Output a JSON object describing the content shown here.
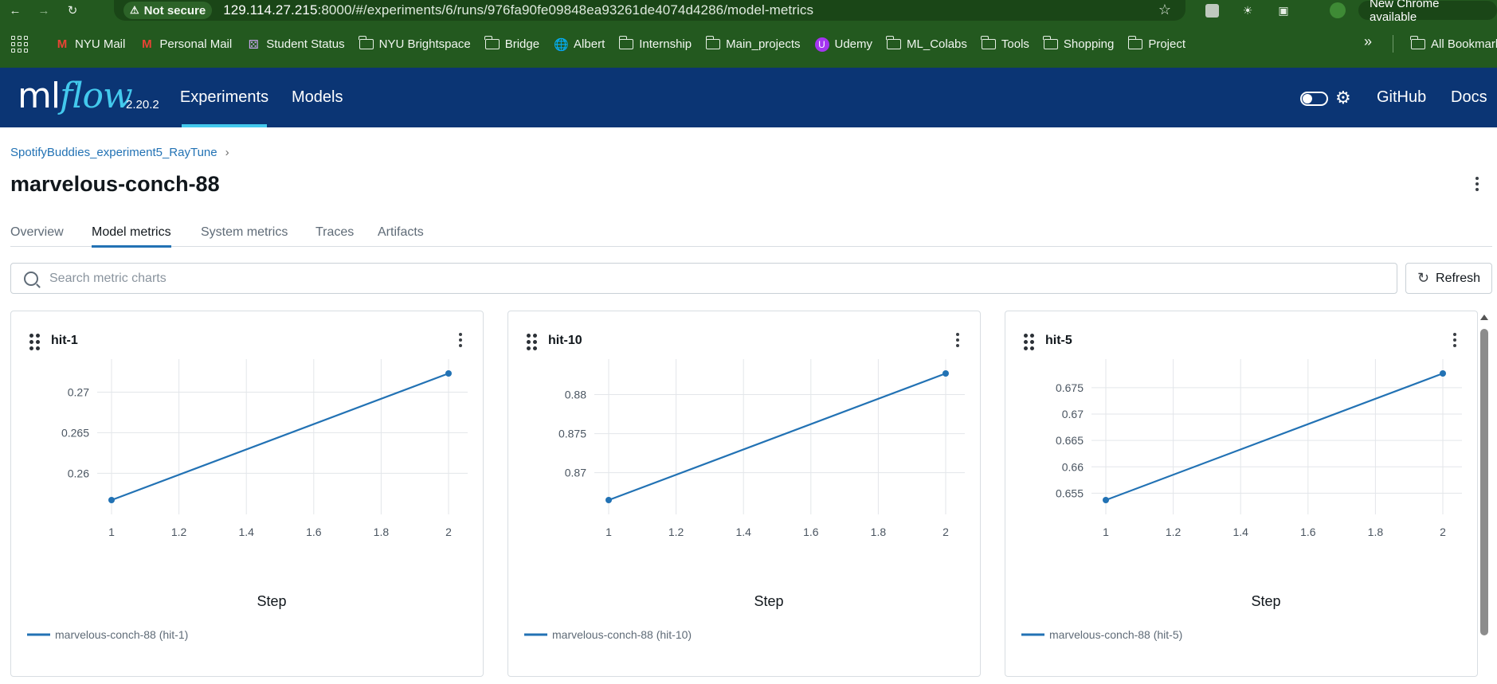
{
  "browser": {
    "security_label": "Not secure",
    "url_host": "129.114.27.215",
    "url_rest": ":8000/#/experiments/6/runs/976fa90fe09848ea93261de4074d4286/model-metrics",
    "new_chrome_label": "New Chrome available"
  },
  "bookmarks": [
    {
      "label": "NYU Mail",
      "icon": "gmail-icon"
    },
    {
      "label": "Personal Mail",
      "icon": "gmail-icon"
    },
    {
      "label": "Student Status",
      "icon": "nyu-icon"
    },
    {
      "label": "NYU Brightspace",
      "icon": "folder-icon"
    },
    {
      "label": "Bridge",
      "icon": "folder-icon"
    },
    {
      "label": "Albert",
      "icon": "globe-icon"
    },
    {
      "label": "Internship",
      "icon": "folder-icon"
    },
    {
      "label": "Main_projects",
      "icon": "folder-icon"
    },
    {
      "label": "Udemy",
      "icon": "udemy-icon"
    },
    {
      "label": "ML_Colabs",
      "icon": "folder-icon"
    },
    {
      "label": "Tools",
      "icon": "folder-icon"
    },
    {
      "label": "Shopping",
      "icon": "folder-icon"
    },
    {
      "label": "Project",
      "icon": "folder-icon"
    }
  ],
  "bookmarks_all": "All Bookmarks",
  "header": {
    "logo_ml": "ml",
    "logo_flow": "flow",
    "version": "2.20.2",
    "nav": [
      "Experiments",
      "Models"
    ],
    "links": [
      "GitHub",
      "Docs"
    ],
    "accent_color": "#43c9ed",
    "background_color": "#0b3574"
  },
  "breadcrumb": {
    "experiment": "SpotifyBuddies_experiment5_RayTune",
    "separator": "›"
  },
  "page_title": "marvelous-conch-88",
  "tabs": [
    "Overview",
    "Model metrics",
    "System metrics",
    "Traces",
    "Artifacts"
  ],
  "active_tab": "Model metrics",
  "search": {
    "placeholder": "Search metric charts"
  },
  "refresh_label": "Refresh",
  "charts": [
    {
      "title": "hit-1",
      "legend": "marvelous-conch-88 (hit-1)",
      "xlabel": "Step",
      "xticks": [
        "1",
        "1.2",
        "1.4",
        "1.6",
        "1.8",
        "2"
      ],
      "yticks": [
        "0.26",
        "0.265",
        "0.27"
      ]
    },
    {
      "title": "hit-10",
      "legend": "marvelous-conch-88 (hit-10)",
      "xlabel": "Step",
      "xticks": [
        "1",
        "1.2",
        "1.4",
        "1.6",
        "1.8",
        "2"
      ],
      "yticks": [
        "0.87",
        "0.875",
        "0.88"
      ]
    },
    {
      "title": "hit-5",
      "legend": "marvelous-conch-88 (hit-5)",
      "xlabel": "Step",
      "xticks": [
        "1",
        "1.2",
        "1.4",
        "1.6",
        "1.8",
        "2"
      ],
      "yticks": [
        "0.655",
        "0.66",
        "0.665",
        "0.67",
        "0.675"
      ]
    }
  ],
  "chart_data": [
    {
      "type": "line",
      "title": "hit-1",
      "xlabel": "Step",
      "ylabel": "",
      "xlim": [
        1,
        2
      ],
      "ylim": [
        0.2567,
        0.2723
      ],
      "x": [
        1,
        2
      ],
      "series": [
        {
          "name": "marvelous-conch-88 (hit-1)",
          "color": "#2272b4",
          "values": [
            0.2567,
            0.2723
          ]
        }
      ],
      "grid": true,
      "legend_position": "bottom-left"
    },
    {
      "type": "line",
      "title": "hit-10",
      "xlabel": "Step",
      "ylabel": "",
      "xlim": [
        1,
        2
      ],
      "ylim": [
        0.8665,
        0.8827
      ],
      "x": [
        1,
        2
      ],
      "series": [
        {
          "name": "marvelous-conch-88 (hit-10)",
          "color": "#2272b4",
          "values": [
            0.8665,
            0.8827
          ]
        }
      ],
      "grid": true,
      "legend_position": "bottom-left"
    },
    {
      "type": "line",
      "title": "hit-5",
      "xlabel": "Step",
      "ylabel": "",
      "xlim": [
        1,
        2
      ],
      "ylim": [
        0.6537,
        0.6777
      ],
      "x": [
        1,
        2
      ],
      "series": [
        {
          "name": "marvelous-conch-88 (hit-5)",
          "color": "#2272b4",
          "values": [
            0.6537,
            0.6777
          ]
        }
      ],
      "grid": true,
      "legend_position": "bottom-left"
    }
  ]
}
